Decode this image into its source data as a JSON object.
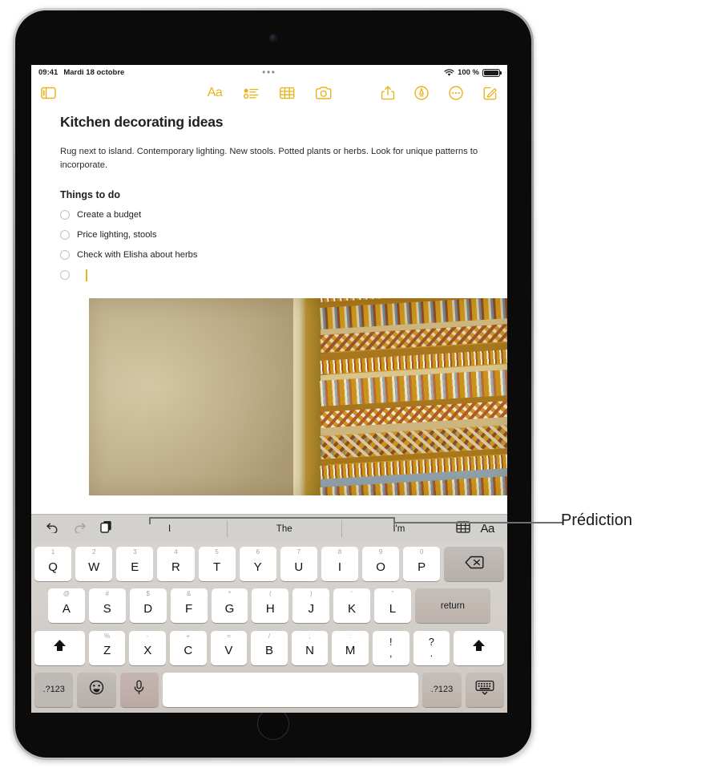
{
  "device": {
    "name": "iPad"
  },
  "status_bar": {
    "time": "09:41",
    "date": "Mardi 18 octobre",
    "dots": "•••",
    "wifi_icon": "wifi-icon",
    "battery_percent": "100 %",
    "battery_icon": "battery-full-icon"
  },
  "toolbar": {
    "sidebar_icon": "sidebar-icon",
    "center_items": [
      {
        "name": "format-text-button",
        "glyph": "Aa"
      },
      {
        "name": "checklist-button",
        "glyph": "checklist-icon"
      },
      {
        "name": "table-button",
        "glyph": "table-icon"
      },
      {
        "name": "camera-button",
        "glyph": "camera-icon"
      }
    ],
    "right_items": [
      {
        "name": "share-button",
        "glyph": "share-icon"
      },
      {
        "name": "markup-button",
        "glyph": "markup-pen-icon"
      },
      {
        "name": "more-button",
        "glyph": "more-circle-icon"
      },
      {
        "name": "compose-button",
        "glyph": "compose-icon"
      }
    ]
  },
  "note": {
    "title": "Kitchen decorating ideas",
    "paragraph": "Rug next to island. Contemporary lighting. New stools. Potted plants or herbs. Look for unique patterns to incorporate.",
    "subheading": "Things to do",
    "checklist": [
      {
        "label": "Create a budget",
        "checked": false
      },
      {
        "label": "Price lighting, stools",
        "checked": false
      },
      {
        "label": "Check with Elisha about herbs",
        "checked": false
      },
      {
        "label": "",
        "checked": false,
        "active": true
      }
    ],
    "photo_alt": "woven ochre textile next to beige wall"
  },
  "prediction_bar": {
    "tools": [
      {
        "name": "undo-button",
        "glyph": "undo-icon",
        "enabled": true
      },
      {
        "name": "redo-button",
        "glyph": "redo-icon",
        "enabled": false
      },
      {
        "name": "paste-button",
        "glyph": "paste-icon",
        "enabled": true
      }
    ],
    "words": [
      "I",
      "The",
      "I'm"
    ],
    "right_tools": [
      {
        "name": "table-button",
        "glyph": "table-icon"
      },
      {
        "name": "format-text-button",
        "glyph": "Aa"
      }
    ]
  },
  "keyboard": {
    "row1": [
      {
        "main": "Q",
        "alt": "1"
      },
      {
        "main": "W",
        "alt": "2"
      },
      {
        "main": "E",
        "alt": "3"
      },
      {
        "main": "R",
        "alt": "4"
      },
      {
        "main": "T",
        "alt": "5"
      },
      {
        "main": "Y",
        "alt": "6"
      },
      {
        "main": "U",
        "alt": "7"
      },
      {
        "main": "I",
        "alt": "8"
      },
      {
        "main": "O",
        "alt": "9"
      },
      {
        "main": "P",
        "alt": "0"
      }
    ],
    "row1_backspace": "backspace-icon",
    "row2": [
      {
        "main": "A",
        "alt": "@"
      },
      {
        "main": "S",
        "alt": "#"
      },
      {
        "main": "D",
        "alt": "$"
      },
      {
        "main": "F",
        "alt": "&"
      },
      {
        "main": "G",
        "alt": "*"
      },
      {
        "main": "H",
        "alt": "("
      },
      {
        "main": "J",
        "alt": ")"
      },
      {
        "main": "K",
        "alt": "'"
      },
      {
        "main": "L",
        "alt": "\""
      }
    ],
    "row2_return": "return",
    "row3_shift_left": "shift-icon",
    "row3": [
      {
        "main": "Z",
        "alt": "%"
      },
      {
        "main": "X",
        "alt": "-"
      },
      {
        "main": "C",
        "alt": "+"
      },
      {
        "main": "V",
        "alt": "="
      },
      {
        "main": "B",
        "alt": "/"
      },
      {
        "main": "N",
        "alt": ";"
      },
      {
        "main": "M",
        "alt": ":"
      }
    ],
    "row3_punct": [
      {
        "top": "!",
        "bottom": ","
      },
      {
        "top": "?",
        "bottom": "."
      }
    ],
    "row3_shift_right": "shift-icon",
    "row4": {
      "numbers_left": ".?123",
      "emoji": "emoji-icon",
      "dictation": "microphone-icon",
      "space": "",
      "numbers_right": ".?123",
      "dismiss": "hide-keyboard-icon"
    }
  },
  "callout": {
    "label": "Prédiction"
  },
  "colors": {
    "accent": "#eab21f",
    "keyboard_bg": "#d2cdc8",
    "prediction_bg": "#d3d1ce",
    "key_white": "#ffffff",
    "text": "#1f1f21",
    "callout_line": "#6f6f71"
  }
}
